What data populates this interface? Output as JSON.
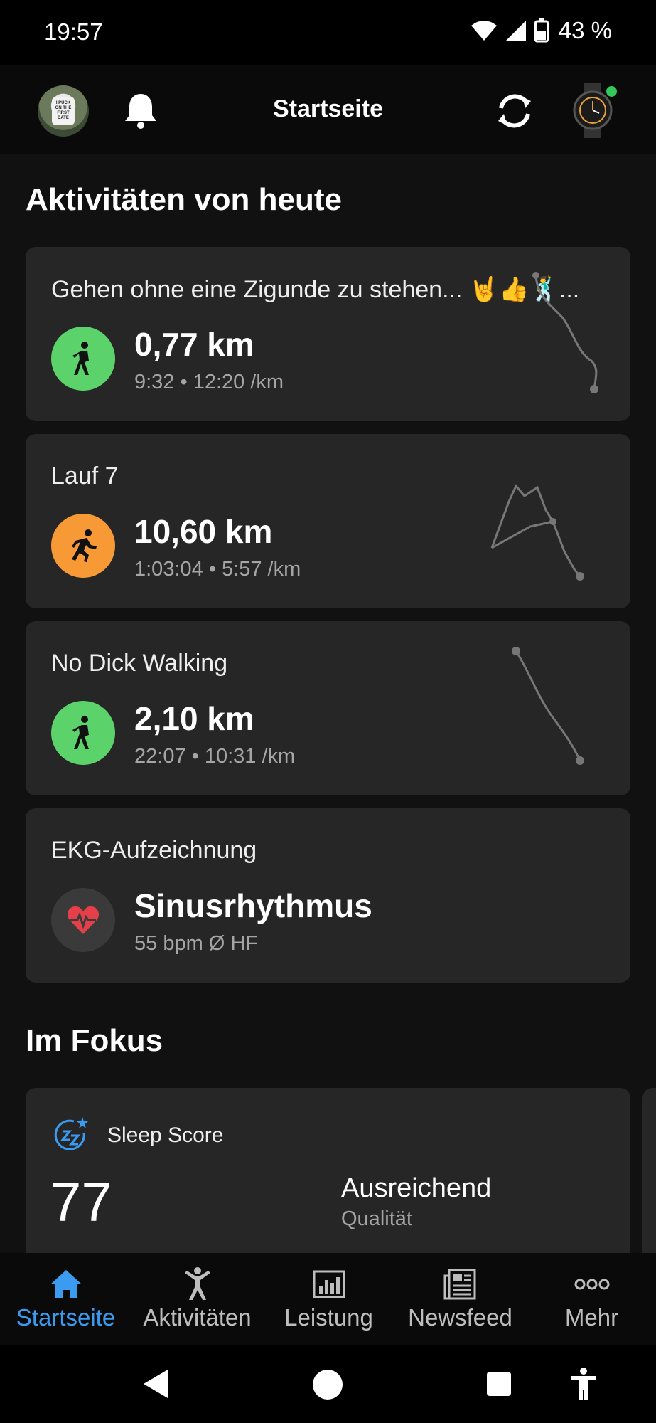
{
  "status_bar": {
    "time": "19:57",
    "battery": "43 %"
  },
  "header": {
    "title": "Startseite"
  },
  "today": {
    "section_title": "Aktivitäten von heute",
    "activities": [
      {
        "title": "Gehen ohne eine Zigunde zu stehen... 🤘👍🕺...",
        "value": "0,77 km",
        "sub": "9:32 • 12:20 /km",
        "icon": "walking-icon",
        "color": "#5cd36a"
      },
      {
        "title": "Lauf 7",
        "value": "10,60 km",
        "sub": "1:03:04 • 5:57 /km",
        "icon": "running-icon",
        "color": "#f79a35"
      },
      {
        "title": "No Dick Walking",
        "value": "2,10 km",
        "sub": "22:07 • 10:31 /km",
        "icon": "walking-icon",
        "color": "#5cd36a"
      },
      {
        "title": "EKG-Aufzeichnung",
        "value": "Sinusrhythmus",
        "sub": "55 bpm Ø HF",
        "icon": "heart-ecg-icon",
        "color": "#e5404a"
      }
    ]
  },
  "focus": {
    "section_title": "Im Fokus",
    "sleep": {
      "label": "Sleep Score",
      "score": "77",
      "quality": "Ausreichend",
      "quality_label": "Qualität",
      "icon": "sleep-score-icon"
    }
  },
  "bottom_nav": {
    "items": [
      {
        "label": "Startseite",
        "icon": "home-icon",
        "active": true
      },
      {
        "label": "Aktivitäten",
        "icon": "activity-person-icon",
        "active": false
      },
      {
        "label": "Leistung",
        "icon": "chart-icon",
        "active": false
      },
      {
        "label": "Newsfeed",
        "icon": "newsfeed-icon",
        "active": false
      },
      {
        "label": "Mehr",
        "icon": "more-icon",
        "active": false
      }
    ],
    "active_color": "#3a9bf0"
  }
}
